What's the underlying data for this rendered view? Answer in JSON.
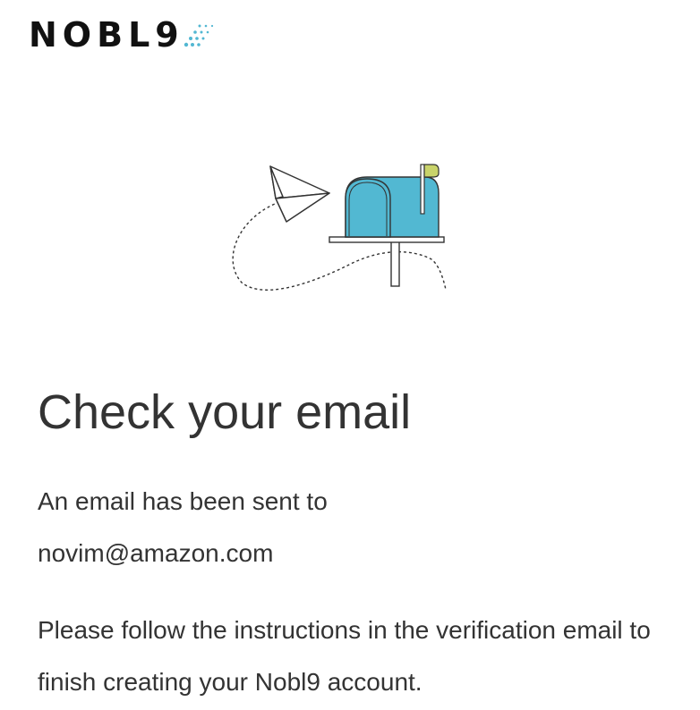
{
  "brand": {
    "name": "NOBL9",
    "dot_color": "#52b7d2"
  },
  "illustration": {
    "icon": "mailbox-with-paper-plane",
    "mailbox_color": "#52b8d2",
    "flag_color": "#c9d36a"
  },
  "content": {
    "title": "Check your email",
    "sent_prefix": "An email has been sent to",
    "email": "novim@amazon.com",
    "instructions": "Please follow the instructions in the verification email to finish creating your Nobl9 account."
  }
}
